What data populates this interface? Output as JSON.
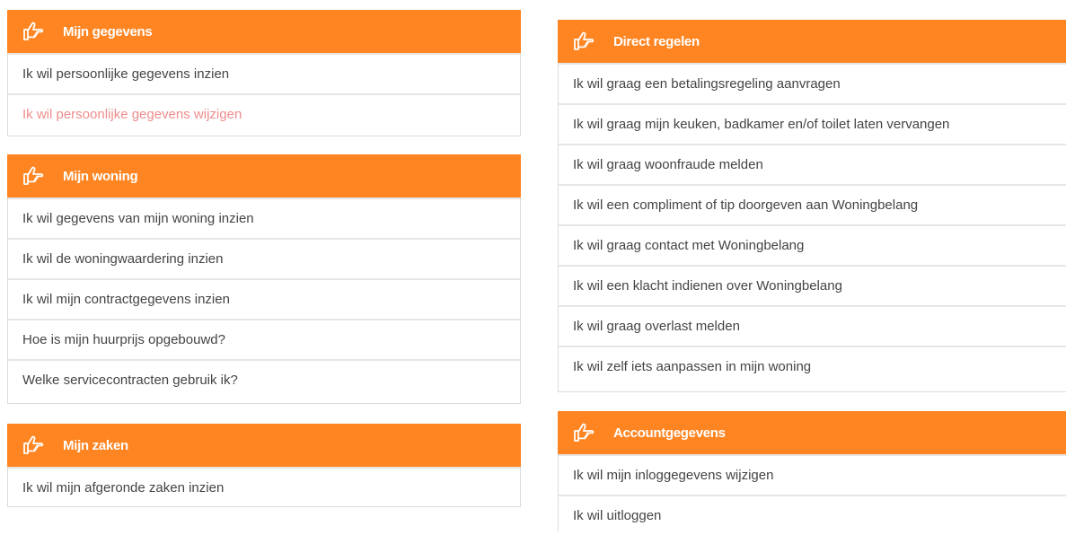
{
  "colors": {
    "header": "#ff8522",
    "active_link": "#f08c8c",
    "text": "#444444"
  },
  "panels": {
    "gegevens": {
      "title": "Mijn gegevens",
      "icon": "pointing-hand-icon",
      "items": [
        {
          "label": "Ik wil persoonlijke gegevens inzien"
        },
        {
          "label": "Ik wil persoonlijke gegevens wijzigen"
        }
      ]
    },
    "woning": {
      "title": "Mijn woning",
      "icon": "pointing-hand-icon",
      "items": [
        {
          "label": "Ik wil gegevens van mijn woning inzien"
        },
        {
          "label": "Ik wil de woningwaardering inzien"
        },
        {
          "label": "Ik wil mijn contractgegevens inzien"
        },
        {
          "label": "Hoe is mijn huurprijs opgebouwd?"
        },
        {
          "label": "Welke servicecontracten gebruik ik?"
        }
      ]
    },
    "zaken": {
      "title": "Mijn zaken",
      "icon": "pointing-hand-icon",
      "items": [
        {
          "label": "Ik wil mijn afgeronde zaken inzien"
        }
      ]
    },
    "direct": {
      "title": "Direct regelen",
      "icon": "pointing-hand-icon",
      "items": [
        {
          "label": "Ik wil graag een betalingsregeling aanvragen"
        },
        {
          "label": "Ik wil graag mijn keuken, badkamer en/of toilet laten vervangen"
        },
        {
          "label": "Ik wil graag woonfraude melden"
        },
        {
          "label": "Ik wil een compliment of tip doorgeven aan Woningbelang"
        },
        {
          "label": "Ik wil graag contact met Woningbelang"
        },
        {
          "label": "Ik wil een klacht indienen over Woningbelang"
        },
        {
          "label": "Ik wil graag overlast melden"
        },
        {
          "label": "Ik wil zelf iets aanpassen in mijn woning"
        }
      ]
    },
    "account": {
      "title": "Accountgegevens",
      "icon": "pointing-hand-icon",
      "items": [
        {
          "label": "Ik wil mijn inloggegevens wijzigen"
        },
        {
          "label": "Ik wil uitloggen"
        }
      ]
    }
  }
}
